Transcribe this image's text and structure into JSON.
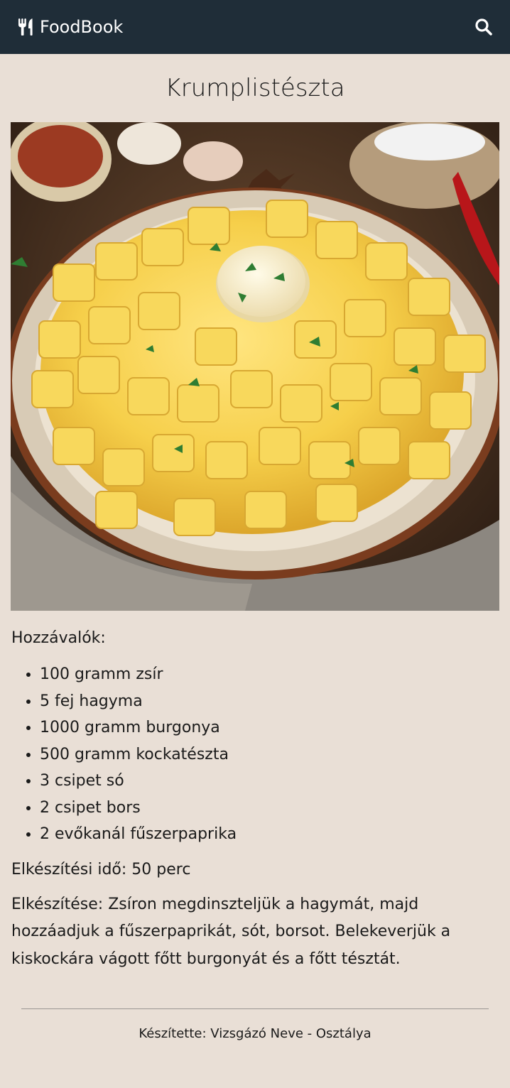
{
  "nav": {
    "brand": "FoodBook",
    "brand_icon": "utensils-icon",
    "search_icon": "search-icon"
  },
  "recipe": {
    "title": "Krumplistészta",
    "ingredients_heading": "Hozzávalók:",
    "ingredients": [
      "100 gramm zsír",
      "5 fej hagyma",
      "1000 gramm burgonya",
      "500 gramm kockatészta",
      "3 csipet só",
      "2 csipet bors",
      "2 evőkanál fűszerpaprika"
    ],
    "time": "Elkészítési idő: 50 perc",
    "method": "Elkészítése: Zsíron megdinszteljük a hagymát, majd hozzáadjuk a fűszerpaprikát, sót, borsot. Belekeverjük a kiskockára vágott főtt burgonyát és a főtt tésztát."
  },
  "footer": {
    "text": "Készítette: Vizsgázó Neve - Osztálya"
  },
  "colors": {
    "navbar": "#1f2d38",
    "background": "#e9dfd6",
    "text": "#1a1a1a"
  }
}
